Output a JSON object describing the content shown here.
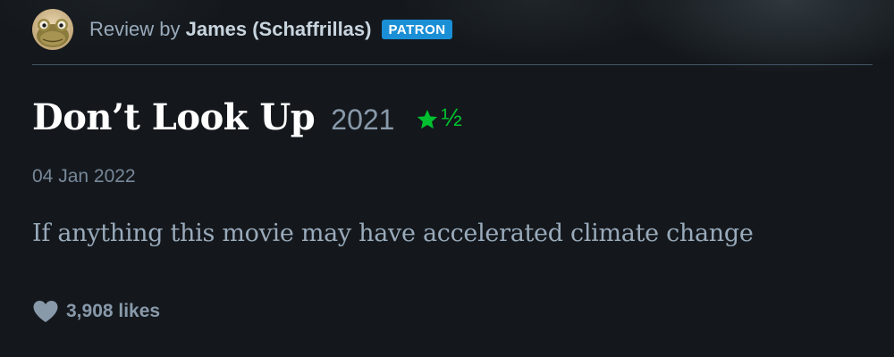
{
  "review_header": {
    "prefix": "Review by",
    "reviewer_name": "James (Schaffrillas)",
    "badge": "PATRON",
    "avatar_icon": "frog-avatar"
  },
  "film": {
    "title": "Don’t Look Up",
    "year": "2021",
    "rating_stars": 1.5,
    "rating_half_glyph": "½",
    "star_icon": "star-icon"
  },
  "review": {
    "date": "04 Jan 2022",
    "text": "If anything this movie may have accelerated climate change"
  },
  "likes": {
    "count_label": "3,908 likes",
    "heart_icon": "heart-icon"
  },
  "colors": {
    "background": "#14181c",
    "rating_green": "#00c030",
    "patron_badge": "#1b8fd6"
  }
}
